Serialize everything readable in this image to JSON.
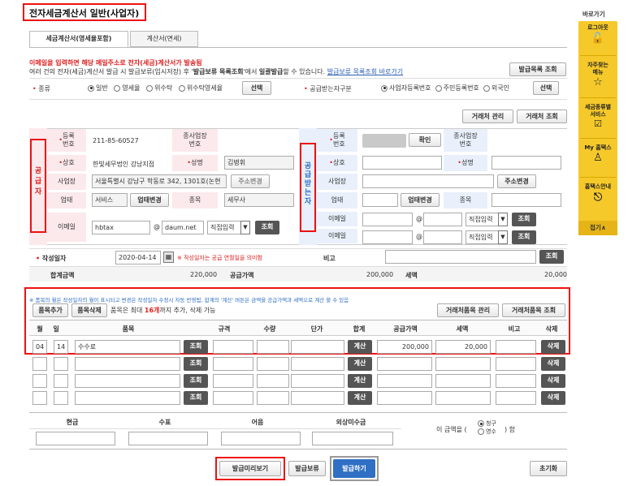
{
  "page": {
    "title": "전자세금계산서 일반(사업자)"
  },
  "tabs": [
    "세금계산서(영세율포함)",
    "계산서(면세)"
  ],
  "notice": {
    "line1": "이메일을 입력하면 해당 메일주소로 전자(세금)계산서가 발송됨",
    "line2_a": "여러 건의 전자(세금)계산서 발급 시 발급보류(임시저장) 후 '",
    "line2_b": "발급보류 목록조회",
    "line2_c": "'에서 ",
    "line2_d": "일괄발급",
    "line2_e": "할 수 있습니다. ",
    "line2_link": "발급보류 목록조회 바로가기",
    "list_btn": "발급목록 조회"
  },
  "kind": {
    "label": "종류",
    "options": [
      "일반",
      "영세율",
      "위수탁",
      "위수탁영세율"
    ],
    "selected": 0,
    "select_btn": "선택"
  },
  "recv_kind": {
    "label": "공급받는자구분",
    "options": [
      "사업자등록번호",
      "주민등록번호",
      "외국인"
    ],
    "selected": 0,
    "select_btn": "선택"
  },
  "partner_btns": {
    "manage": "거래처 관리",
    "search": "거래처 조회"
  },
  "supplier": {
    "side_label": "공급자",
    "reg_label": "등록\n번호",
    "reg_value": "211-85-60527",
    "sub_label": "종사업장\n번호",
    "name_label": "상호",
    "name_value": "한빛세무법인 강남지점",
    "ceo_label": "성명",
    "ceo_value": "김병휘",
    "addr_label": "사업장",
    "addr_value": "서울특별시 강남구 학동로 342, 1301호(논현",
    "addr_btn": "주소변경",
    "type_label": "업태",
    "type_value": "서비스",
    "type_btn": "업태변경",
    "item_label": "종목",
    "item_value": "세무사",
    "email_label": "이메일",
    "email_id": "hbtax",
    "email_at": "@",
    "email_domain": "daum.net",
    "email_select": "직접입력",
    "email_btn": "조회"
  },
  "receiver": {
    "side_label": "공급받는자",
    "reg_label": "등록\n번호",
    "confirm_btn": "확인",
    "sub_label": "종사업장\n번호",
    "name_label": "상호",
    "ceo_label": "성명",
    "addr_label": "사업장",
    "addr_btn": "주소변경",
    "type_label": "업태",
    "type_btn": "업태변경",
    "item_label": "종목",
    "email_label": "이메일",
    "email2_label": "이메일",
    "email_at": "@",
    "email_select": "직접입력",
    "email_btn": "조회"
  },
  "write_date": {
    "label": "작성일자",
    "value": "2020-04-14",
    "hint": "※ 작성일자는 공급 연월일을 의미함"
  },
  "memo": {
    "label": "비고",
    "btn": "조회"
  },
  "totals": {
    "total_label": "합계금액",
    "total_value": "220,000",
    "supply_label": "공급가액",
    "supply_value": "200,000",
    "tax_label": "세액",
    "tax_value": "20,000"
  },
  "items_notice": "※ 품목의 월은 작성일자의 월이 표시되고 변경은 작성일자 수정시 자동 반영됨, 합계의 '계산' 버튼은 금액을 공급가액과 세액으로 계산 할 수 있음",
  "item_btns": {
    "add": "품목추가",
    "del": "품목삭제",
    "limit_a": "품목은 최대 ",
    "limit_b": "16개",
    "limit_c": "까지 추가, 삭제 가능",
    "manage": "거래처품목 관리",
    "search": "거래처품목 조회"
  },
  "table_headers": [
    "월",
    "일",
    "품목",
    "규격",
    "수량",
    "단가",
    "합계",
    "공급가액",
    "세액",
    "비고",
    "삭제"
  ],
  "rows": [
    {
      "month": "04",
      "day": "14",
      "item": "수수료",
      "supply": "200,000",
      "tax": "20,000"
    },
    {
      "month": "",
      "day": "",
      "item": "",
      "supply": "",
      "tax": ""
    },
    {
      "month": "",
      "day": "",
      "item": "",
      "supply": "",
      "tax": ""
    },
    {
      "month": "",
      "day": "",
      "item": "",
      "supply": "",
      "tax": ""
    },
    {
      "month": "",
      "day": "",
      "item": "",
      "supply": "",
      "tax": ""
    }
  ],
  "row_btns": {
    "search": "조회",
    "calc": "계산",
    "del": "삭제"
  },
  "payment": {
    "headers": [
      "현금",
      "수표",
      "어음",
      "외상미수금"
    ],
    "claim_a": "이 금액을 (",
    "claim_opts": [
      "청구",
      "영수"
    ],
    "claim_selected": 0,
    "claim_b": ") 함"
  },
  "footer": {
    "preview": "발급미리보기",
    "hold": "발급보류",
    "issue": "발급하기",
    "reset": "초기화"
  },
  "sidebar": {
    "title": "바로가기",
    "items": [
      "로그아웃",
      "자주찾는\n메뉴",
      "세금종류별\n서비스",
      "My 홈택스",
      "홈택스안내"
    ],
    "close": "접기∧"
  },
  "colors": {
    "accent_red": "#e11111",
    "sidebar_yellow": "#f6c92a",
    "issue_blue": "#2f6fc4"
  }
}
